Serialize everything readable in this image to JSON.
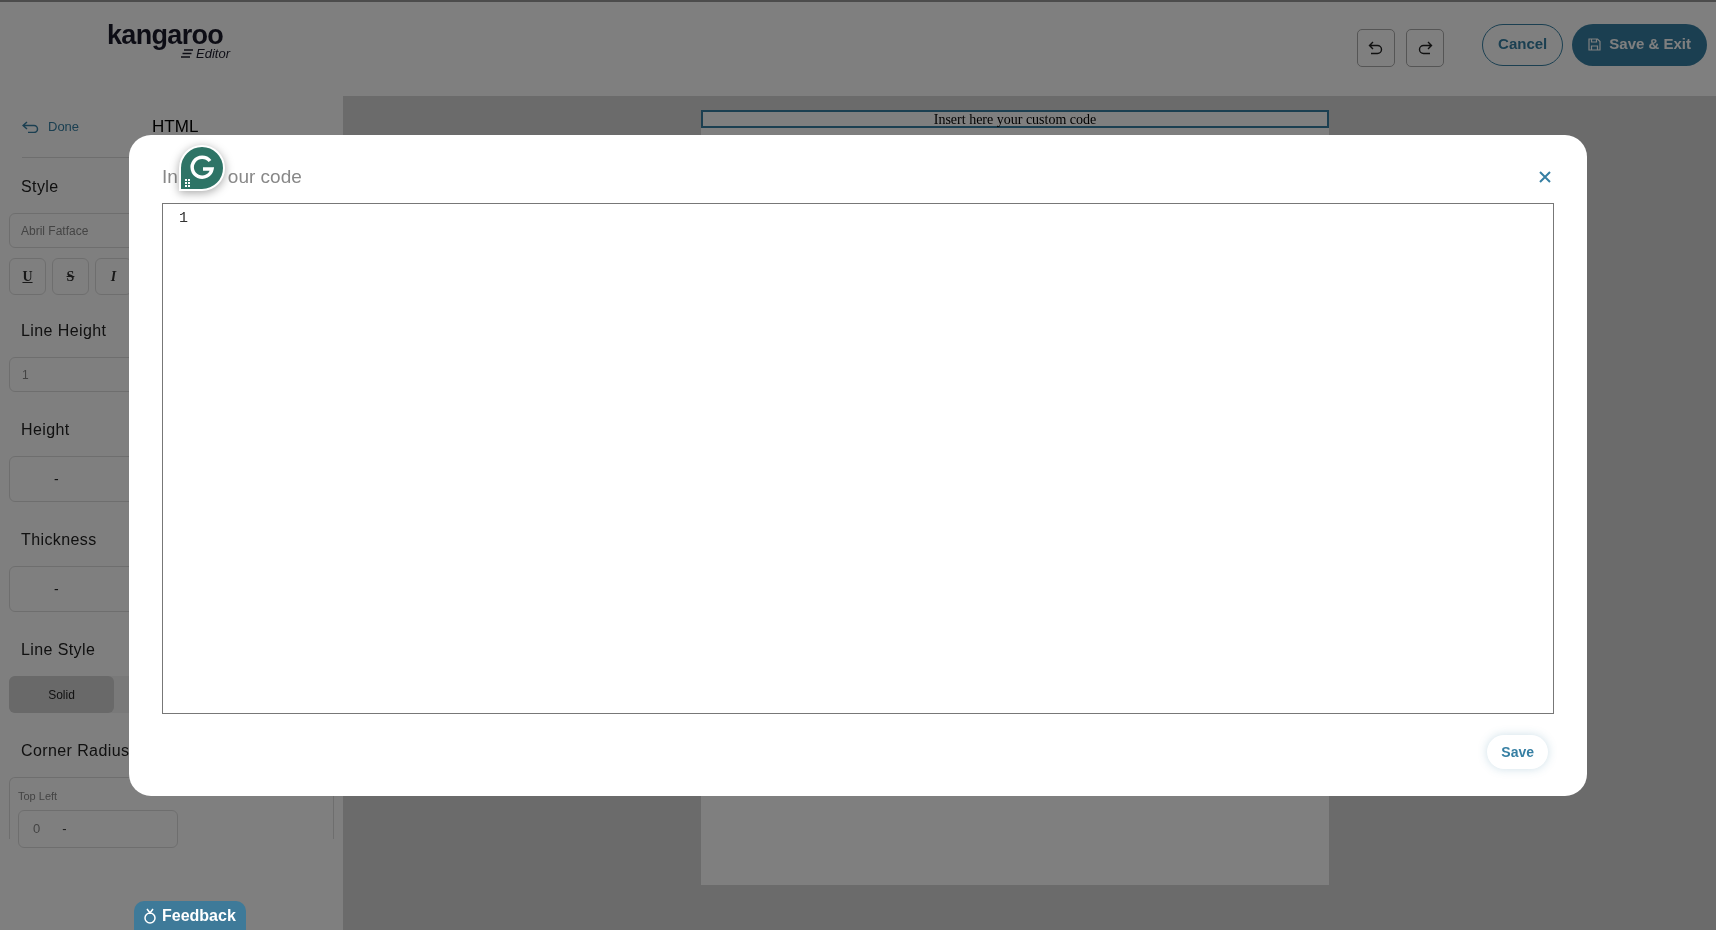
{
  "header": {
    "logo": "kangaroo",
    "logo_sub": "Editor",
    "cancel": "Cancel",
    "save_exit": "Save & Exit"
  },
  "sidebar": {
    "back": "Done",
    "title": "HTML",
    "sections": [
      {
        "kind": "font",
        "label": "Style",
        "value": "Abril Fatface",
        "format_buttons": [
          {
            "label": "U",
            "kind": "underline"
          },
          {
            "label": "S",
            "kind": "strike"
          },
          {
            "label": "I",
            "kind": "italic"
          }
        ]
      },
      {
        "kind": "field",
        "label": "Line Height",
        "value": "1"
      },
      {
        "kind": "stepper",
        "label": "Height",
        "value": "-"
      },
      {
        "kind": "stepper",
        "label": "Thickness",
        "value": "-"
      },
      {
        "kind": "segmented",
        "label": "Line Style",
        "options": [
          {
            "label": "Solid",
            "selected": true
          }
        ]
      },
      {
        "kind": "corners",
        "label": "Corner Radius",
        "corners": [
          {
            "label": "Top Left",
            "value": "0",
            "unit": "-"
          }
        ]
      }
    ]
  },
  "canvas": {
    "custom_code_text": "Insert here your custom code"
  },
  "modal": {
    "title_parts": [
      "In",
      "our code"
    ],
    "line_numbers": [
      "1"
    ],
    "save": "Save"
  },
  "feedback": "Feedback"
}
